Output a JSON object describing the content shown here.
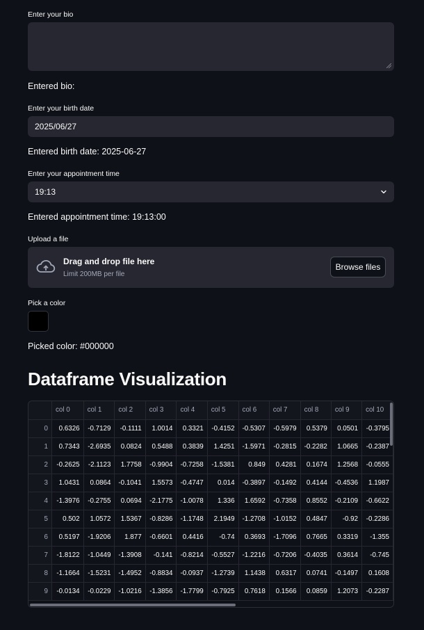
{
  "bio": {
    "label": "Enter your bio",
    "value": "",
    "entered": "Entered bio:"
  },
  "birth_date": {
    "label": "Enter your birth date",
    "value": "2025/06/27",
    "entered": "Entered birth date: 2025-06-27"
  },
  "appointment": {
    "label": "Enter your appointment time",
    "value": "19:13",
    "entered": "Entered appointment time: 19:13:00"
  },
  "upload": {
    "label": "Upload a file",
    "drop_text": "Drag and drop file here",
    "limit_text": "Limit 200MB per file",
    "browse_label": "Browse files",
    "icon": "cloud-upload-icon"
  },
  "color": {
    "label": "Pick a color",
    "value": "#000000",
    "picked": "Picked color: #000000"
  },
  "heading": "Dataframe Visualization",
  "dataframe": {
    "columns": [
      "",
      "col 0",
      "col 1",
      "col 2",
      "col 3",
      "col 4",
      "col 5",
      "col 6",
      "col 7",
      "col 8",
      "col 9",
      "col 10"
    ],
    "rows": [
      [
        "0",
        "0.6326",
        "-0.7129",
        "-0.1111",
        "1.0014",
        "0.3321",
        "-0.4152",
        "-0.5307",
        "-0.5979",
        "0.5379",
        "0.0501",
        "-0.3795"
      ],
      [
        "1",
        "0.7343",
        "-2.6935",
        "0.0824",
        "0.5488",
        "0.3839",
        "1.4251",
        "-1.5971",
        "-0.2815",
        "-0.2282",
        "1.0665",
        "-0.2387"
      ],
      [
        "2",
        "-0.2625",
        "-2.1123",
        "1.7758",
        "-0.9904",
        "-0.7258",
        "-1.5381",
        "0.849",
        "0.4281",
        "0.1674",
        "1.2568",
        "-0.0555"
      ],
      [
        "3",
        "1.0431",
        "0.0864",
        "-0.1041",
        "1.5573",
        "-0.4747",
        "0.014",
        "-0.3897",
        "-0.1492",
        "0.4144",
        "-0.4536",
        "1.1987"
      ],
      [
        "4",
        "-1.3976",
        "-0.2755",
        "0.0694",
        "-2.1775",
        "-1.0078",
        "1.336",
        "1.6592",
        "-0.7358",
        "0.8552",
        "-0.2109",
        "-0.6622"
      ],
      [
        "5",
        "0.502",
        "1.0572",
        "1.5367",
        "-0.8286",
        "-1.1748",
        "2.1949",
        "-1.2708",
        "-1.0152",
        "0.4847",
        "-0.92",
        "-0.2286"
      ],
      [
        "6",
        "0.5197",
        "-1.9206",
        "1.877",
        "-0.6601",
        "0.4416",
        "-0.74",
        "0.3693",
        "-1.7096",
        "0.7665",
        "0.3319",
        "-1.355"
      ],
      [
        "7",
        "-1.8122",
        "-1.0449",
        "-1.3908",
        "-0.141",
        "-0.8214",
        "-0.5527",
        "-1.2216",
        "-0.7206",
        "-0.4035",
        "0.3614",
        "-0.745"
      ],
      [
        "8",
        "-1.1664",
        "-1.5231",
        "-1.4952",
        "-0.8834",
        "-0.0937",
        "-1.2739",
        "1.1438",
        "0.6317",
        "0.0741",
        "-0.1497",
        "0.1608"
      ],
      [
        "9",
        "-0.0134",
        "-0.0229",
        "-1.0216",
        "-1.3856",
        "-1.7799",
        "-0.7925",
        "0.7618",
        "0.1566",
        "0.0859",
        "1.2073",
        "-0.2287"
      ]
    ]
  }
}
